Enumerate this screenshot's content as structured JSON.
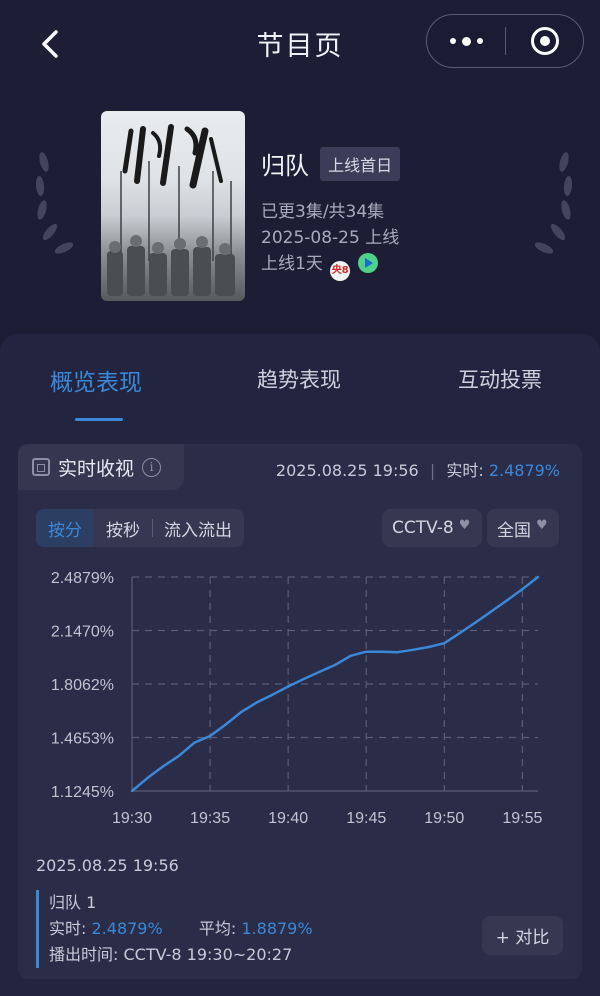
{
  "header": {
    "title": "节目页"
  },
  "program": {
    "name": "归队",
    "tag": "上线首日",
    "episodes": "已更3集/共34集",
    "launch_date": "2025-08-25 上线",
    "online_days": "上线1天",
    "channel_badge": "央8"
  },
  "tabs": [
    {
      "label": "概览表现",
      "active": true
    },
    {
      "label": "趋势表现",
      "active": false
    },
    {
      "label": "互动投票",
      "active": false
    }
  ],
  "realtime": {
    "label": "实时收视",
    "timestamp": "2025.08.25 19:56",
    "now_label": "实时:",
    "now_value": "2.4879%"
  },
  "controls": {
    "segments": [
      "按分",
      "按秒",
      "流入流出"
    ],
    "channel": "CCTV-8",
    "region": "全国"
  },
  "chart_data": {
    "type": "line",
    "x": [
      "19:30",
      "19:31",
      "19:32",
      "19:33",
      "19:34",
      "19:35",
      "19:36",
      "19:37",
      "19:38",
      "19:39",
      "19:40",
      "19:41",
      "19:42",
      "19:43",
      "19:44",
      "19:45",
      "19:46",
      "19:47",
      "19:48",
      "19:49",
      "19:50",
      "19:51",
      "19:52",
      "19:53",
      "19:54",
      "19:55",
      "19:56"
    ],
    "values": [
      1.1245,
      1.208,
      1.282,
      1.348,
      1.433,
      1.475,
      1.548,
      1.628,
      1.689,
      1.738,
      1.79,
      1.838,
      1.883,
      1.927,
      1.986,
      2.012,
      2.012,
      2.009,
      2.024,
      2.042,
      2.066,
      2.131,
      2.198,
      2.268,
      2.338,
      2.411,
      2.4879
    ],
    "xticks": [
      "19:30",
      "19:35",
      "19:40",
      "19:45",
      "19:50",
      "19:55"
    ],
    "yticks": [
      "2.4879%",
      "2.1470%",
      "1.8062%",
      "1.4653%",
      "1.1245%"
    ],
    "ylim": [
      1.1245,
      2.4879
    ],
    "grid": true,
    "color": "#3b88d8"
  },
  "tooltip": {
    "time": "2025.08.25 19:56",
    "series_name": "归队 1",
    "now_label": "实时:",
    "now_value": "2.4879%",
    "avg_label": "平均:",
    "avg_value": "1.8879%",
    "air_time_label": "播出时间:",
    "air_time_value": "CCTV-8 19:30~20:27"
  },
  "compare_label": "+ 对比"
}
